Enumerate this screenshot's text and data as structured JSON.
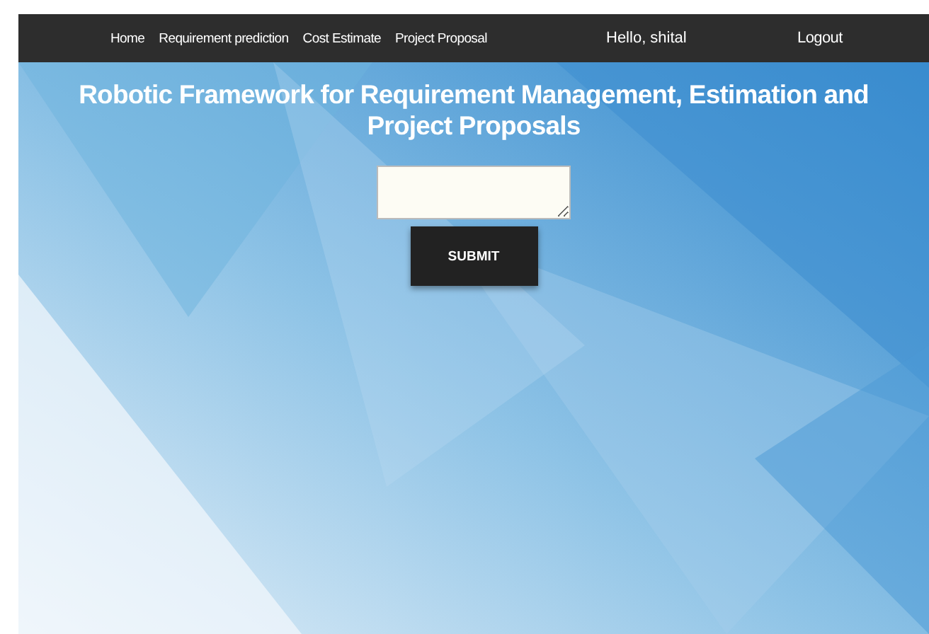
{
  "nav": {
    "links": [
      {
        "label": "Home"
      },
      {
        "label": "Requirement prediction"
      },
      {
        "label": "Cost Estimate"
      },
      {
        "label": "Project Proposal"
      }
    ],
    "greeting": "Hello, shital",
    "logout": "Logout"
  },
  "hero": {
    "title": "Robotic Framework for Requirement Management, Estimation and Project Proposals"
  },
  "form": {
    "submit": "SUBMIT"
  }
}
